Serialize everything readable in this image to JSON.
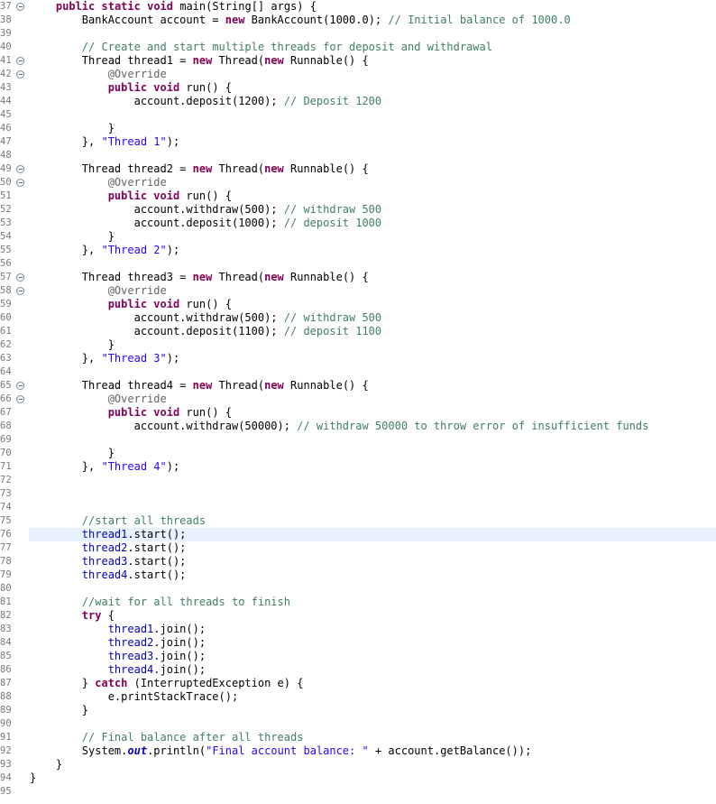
{
  "editor": {
    "current_line": 76,
    "lines": [
      {
        "n": "37",
        "fold": true,
        "tokens": [
          [
            "p",
            "    "
          ],
          [
            "kw",
            "public"
          ],
          [
            "p",
            " "
          ],
          [
            "kw",
            "static"
          ],
          [
            "p",
            " "
          ],
          [
            "kw",
            "void"
          ],
          [
            "p",
            " main(String[] args) {"
          ]
        ]
      },
      {
        "n": "38",
        "fold": false,
        "tokens": [
          [
            "p",
            "        BankAccount account = "
          ],
          [
            "kw",
            "new"
          ],
          [
            "p",
            " BankAccount(1000.0); "
          ],
          [
            "com",
            "// Initial balance of 1000.0"
          ]
        ]
      },
      {
        "n": "39",
        "fold": false,
        "tokens": []
      },
      {
        "n": "40",
        "fold": false,
        "tokens": [
          [
            "p",
            "        "
          ],
          [
            "com",
            "// Create and start multiple threads for deposit and withdrawal"
          ]
        ]
      },
      {
        "n": "41",
        "fold": true,
        "tokens": [
          [
            "p",
            "        Thread thread1 = "
          ],
          [
            "kw",
            "new"
          ],
          [
            "p",
            " Thread("
          ],
          [
            "kw",
            "new"
          ],
          [
            "p",
            " Runnable() {"
          ]
        ]
      },
      {
        "n": "42",
        "fold": true,
        "tokens": [
          [
            "p",
            "            "
          ],
          [
            "ann",
            "@Override"
          ]
        ]
      },
      {
        "n": "43",
        "fold": false,
        "tokens": [
          [
            "p",
            "            "
          ],
          [
            "kw",
            "public"
          ],
          [
            "p",
            " "
          ],
          [
            "kw",
            "void"
          ],
          [
            "p",
            " run() {"
          ]
        ]
      },
      {
        "n": "44",
        "fold": false,
        "tokens": [
          [
            "p",
            "                account.deposit(1200); "
          ],
          [
            "com",
            "// Deposit 1200"
          ]
        ]
      },
      {
        "n": "45",
        "fold": false,
        "tokens": []
      },
      {
        "n": "46",
        "fold": false,
        "tokens": [
          [
            "p",
            "            }"
          ]
        ]
      },
      {
        "n": "47",
        "fold": false,
        "tokens": [
          [
            "p",
            "        }, "
          ],
          [
            "str",
            "\"Thread 1\""
          ],
          [
            "p",
            ");"
          ]
        ]
      },
      {
        "n": "48",
        "fold": false,
        "tokens": []
      },
      {
        "n": "49",
        "fold": true,
        "tokens": [
          [
            "p",
            "        Thread thread2 = "
          ],
          [
            "kw",
            "new"
          ],
          [
            "p",
            " Thread("
          ],
          [
            "kw",
            "new"
          ],
          [
            "p",
            " Runnable() {"
          ]
        ]
      },
      {
        "n": "50",
        "fold": true,
        "tokens": [
          [
            "p",
            "            "
          ],
          [
            "ann",
            "@Override"
          ]
        ]
      },
      {
        "n": "51",
        "fold": false,
        "tokens": [
          [
            "p",
            "            "
          ],
          [
            "kw",
            "public"
          ],
          [
            "p",
            " "
          ],
          [
            "kw",
            "void"
          ],
          [
            "p",
            " run() {"
          ]
        ]
      },
      {
        "n": "52",
        "fold": false,
        "tokens": [
          [
            "p",
            "                account.withdraw(500); "
          ],
          [
            "com",
            "// withdraw 500"
          ]
        ]
      },
      {
        "n": "53",
        "fold": false,
        "tokens": [
          [
            "p",
            "                account.deposit(1000); "
          ],
          [
            "com",
            "// deposit 1000"
          ]
        ]
      },
      {
        "n": "54",
        "fold": false,
        "tokens": [
          [
            "p",
            "            }"
          ]
        ]
      },
      {
        "n": "55",
        "fold": false,
        "tokens": [
          [
            "p",
            "        }, "
          ],
          [
            "str",
            "\"Thread 2\""
          ],
          [
            "p",
            ");"
          ]
        ]
      },
      {
        "n": "56",
        "fold": false,
        "tokens": []
      },
      {
        "n": "57",
        "fold": true,
        "tokens": [
          [
            "p",
            "        Thread thread3 = "
          ],
          [
            "kw",
            "new"
          ],
          [
            "p",
            " Thread("
          ],
          [
            "kw",
            "new"
          ],
          [
            "p",
            " Runnable() {"
          ]
        ]
      },
      {
        "n": "58",
        "fold": true,
        "tokens": [
          [
            "p",
            "            "
          ],
          [
            "ann",
            "@Override"
          ]
        ]
      },
      {
        "n": "59",
        "fold": false,
        "tokens": [
          [
            "p",
            "            "
          ],
          [
            "kw",
            "public"
          ],
          [
            "p",
            " "
          ],
          [
            "kw",
            "void"
          ],
          [
            "p",
            " run() {"
          ]
        ]
      },
      {
        "n": "60",
        "fold": false,
        "tokens": [
          [
            "p",
            "                account.withdraw(500); "
          ],
          [
            "com",
            "// withdraw 500"
          ]
        ]
      },
      {
        "n": "61",
        "fold": false,
        "tokens": [
          [
            "p",
            "                account.deposit(1100); "
          ],
          [
            "com",
            "// deposit 1100"
          ]
        ]
      },
      {
        "n": "62",
        "fold": false,
        "tokens": [
          [
            "p",
            "            }"
          ]
        ]
      },
      {
        "n": "63",
        "fold": false,
        "tokens": [
          [
            "p",
            "        }, "
          ],
          [
            "str",
            "\"Thread 3\""
          ],
          [
            "p",
            ");"
          ]
        ]
      },
      {
        "n": "64",
        "fold": false,
        "tokens": []
      },
      {
        "n": "65",
        "fold": true,
        "tokens": [
          [
            "p",
            "        Thread thread4 = "
          ],
          [
            "kw",
            "new"
          ],
          [
            "p",
            " Thread("
          ],
          [
            "kw",
            "new"
          ],
          [
            "p",
            " Runnable() {"
          ]
        ]
      },
      {
        "n": "66",
        "fold": true,
        "tokens": [
          [
            "p",
            "            "
          ],
          [
            "ann",
            "@Override"
          ]
        ]
      },
      {
        "n": "67",
        "fold": false,
        "tokens": [
          [
            "p",
            "            "
          ],
          [
            "kw",
            "public"
          ],
          [
            "p",
            " "
          ],
          [
            "kw",
            "void"
          ],
          [
            "p",
            " run() {"
          ]
        ]
      },
      {
        "n": "68",
        "fold": false,
        "tokens": [
          [
            "p",
            "                account.withdraw(50000); "
          ],
          [
            "com",
            "// withdraw 50000 to throw error of insufficient funds"
          ]
        ]
      },
      {
        "n": "69",
        "fold": false,
        "tokens": []
      },
      {
        "n": "70",
        "fold": false,
        "tokens": [
          [
            "p",
            "            }"
          ]
        ]
      },
      {
        "n": "71",
        "fold": false,
        "tokens": [
          [
            "p",
            "        }, "
          ],
          [
            "str",
            "\"Thread 4\""
          ],
          [
            "p",
            ");"
          ]
        ]
      },
      {
        "n": "72",
        "fold": false,
        "tokens": []
      },
      {
        "n": "73",
        "fold": false,
        "tokens": []
      },
      {
        "n": "74",
        "fold": false,
        "tokens": []
      },
      {
        "n": "75",
        "fold": false,
        "tokens": [
          [
            "p",
            "        "
          ],
          [
            "com",
            "//start all threads"
          ]
        ]
      },
      {
        "n": "76",
        "fold": false,
        "tokens": [
          [
            "p",
            "        "
          ],
          [
            "fld",
            "thread1"
          ],
          [
            "p",
            ".start();"
          ]
        ]
      },
      {
        "n": "77",
        "fold": false,
        "tokens": [
          [
            "p",
            "        "
          ],
          [
            "fld",
            "thread2"
          ],
          [
            "p",
            ".start();"
          ]
        ]
      },
      {
        "n": "78",
        "fold": false,
        "tokens": [
          [
            "p",
            "        "
          ],
          [
            "fld",
            "thread3"
          ],
          [
            "p",
            ".start();"
          ]
        ]
      },
      {
        "n": "79",
        "fold": false,
        "tokens": [
          [
            "p",
            "        "
          ],
          [
            "fld",
            "thread4"
          ],
          [
            "p",
            ".start();"
          ]
        ]
      },
      {
        "n": "80",
        "fold": false,
        "tokens": []
      },
      {
        "n": "81",
        "fold": false,
        "tokens": [
          [
            "p",
            "        "
          ],
          [
            "com",
            "//wait for all threads to finish"
          ]
        ]
      },
      {
        "n": "82",
        "fold": false,
        "tokens": [
          [
            "p",
            "        "
          ],
          [
            "kw",
            "try"
          ],
          [
            "p",
            " {"
          ]
        ]
      },
      {
        "n": "83",
        "fold": false,
        "tokens": [
          [
            "p",
            "            "
          ],
          [
            "fld",
            "thread1"
          ],
          [
            "p",
            ".join();"
          ]
        ]
      },
      {
        "n": "84",
        "fold": false,
        "tokens": [
          [
            "p",
            "            "
          ],
          [
            "fld",
            "thread2"
          ],
          [
            "p",
            ".join();"
          ]
        ]
      },
      {
        "n": "85",
        "fold": false,
        "tokens": [
          [
            "p",
            "            "
          ],
          [
            "fld",
            "thread3"
          ],
          [
            "p",
            ".join();"
          ]
        ]
      },
      {
        "n": "86",
        "fold": false,
        "tokens": [
          [
            "p",
            "            "
          ],
          [
            "fld",
            "thread4"
          ],
          [
            "p",
            ".join();"
          ]
        ]
      },
      {
        "n": "87",
        "fold": false,
        "tokens": [
          [
            "p",
            "        } "
          ],
          [
            "kw",
            "catch"
          ],
          [
            "p",
            " (InterruptedException e) {"
          ]
        ]
      },
      {
        "n": "88",
        "fold": false,
        "tokens": [
          [
            "p",
            "            e.printStackTrace();"
          ]
        ]
      },
      {
        "n": "89",
        "fold": false,
        "tokens": [
          [
            "p",
            "        }"
          ]
        ]
      },
      {
        "n": "90",
        "fold": false,
        "tokens": []
      },
      {
        "n": "91",
        "fold": false,
        "tokens": [
          [
            "p",
            "        "
          ],
          [
            "com",
            "// Final balance after all threads"
          ]
        ]
      },
      {
        "n": "92",
        "fold": false,
        "tokens": [
          [
            "p",
            "        System."
          ],
          [
            "sfld",
            "out"
          ],
          [
            "p",
            ".println("
          ],
          [
            "str",
            "\"Final account balance: \""
          ],
          [
            "p",
            " + account.getBalance());"
          ]
        ]
      },
      {
        "n": "93",
        "fold": false,
        "tokens": [
          [
            "p",
            "    }"
          ]
        ]
      },
      {
        "n": "94",
        "fold": false,
        "tokens": [
          [
            "p",
            "}"
          ]
        ]
      },
      {
        "n": "95",
        "fold": false,
        "tokens": []
      }
    ]
  }
}
